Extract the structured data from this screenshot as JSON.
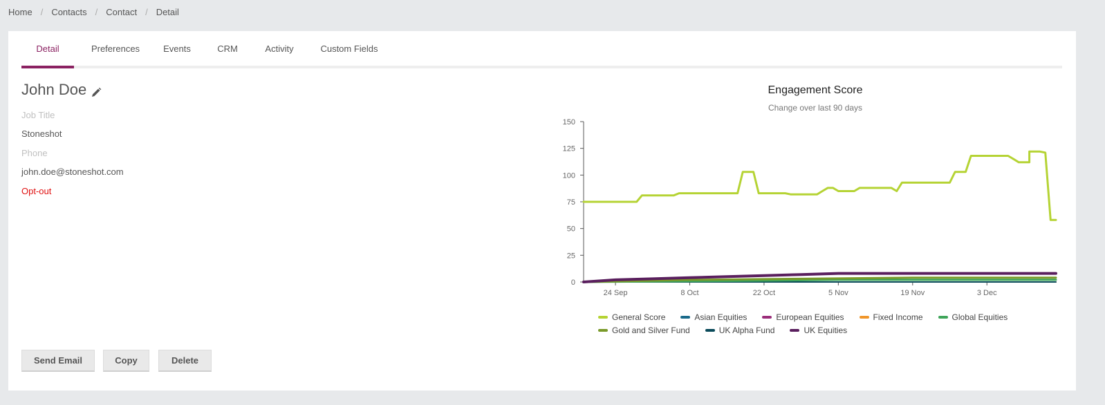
{
  "breadcrumb": [
    "Home",
    "Contacts",
    "Contact",
    "Detail"
  ],
  "breadcrumb_separator": "/",
  "tabs": [
    "Detail",
    "Preferences",
    "Events",
    "CRM",
    "Activity",
    "Custom Fields"
  ],
  "active_tab": "Detail",
  "contact": {
    "name": "John Doe",
    "job_title_placeholder": "Job Title",
    "company": "Stoneshot",
    "phone_placeholder": "Phone",
    "email": "john.doe@stoneshot.com",
    "status": "Opt-out"
  },
  "actions": {
    "send_email": "Send Email",
    "copy": "Copy",
    "delete": "Delete"
  },
  "colors": {
    "accent": "#8b2262",
    "optout": "#e01010"
  },
  "chart_data": {
    "type": "line",
    "title": "Engagement Score",
    "subtitle": "Change over last 90 days",
    "ylim": [
      0,
      150
    ],
    "yticks": [
      0,
      25,
      50,
      75,
      100,
      125,
      150
    ],
    "xlim": [
      "2023-09-18",
      "2023-12-16"
    ],
    "xticks": [
      {
        "x": "2023-09-24",
        "label": "24 Sep"
      },
      {
        "x": "2023-10-08",
        "label": "8 Oct"
      },
      {
        "x": "2023-10-22",
        "label": "22 Oct"
      },
      {
        "x": "2023-11-05",
        "label": "5 Nov"
      },
      {
        "x": "2023-11-19",
        "label": "19 Nov"
      },
      {
        "x": "2023-12-03",
        "label": "3 Dec"
      }
    ],
    "legend_position": "bottom",
    "series": [
      {
        "name": "General Score",
        "color": "#b5d334",
        "width": 3,
        "points": [
          [
            "2023-09-18",
            75
          ],
          [
            "2023-09-28",
            75
          ],
          [
            "2023-09-29",
            81
          ],
          [
            "2023-10-05",
            81
          ],
          [
            "2023-10-06",
            83
          ],
          [
            "2023-10-17",
            83
          ],
          [
            "2023-10-18",
            103
          ],
          [
            "2023-10-20",
            103
          ],
          [
            "2023-10-21",
            83
          ],
          [
            "2023-10-26",
            83
          ],
          [
            "2023-10-27",
            82
          ],
          [
            "2023-11-01",
            82
          ],
          [
            "2023-11-02",
            85
          ],
          [
            "2023-11-03",
            88
          ],
          [
            "2023-11-04",
            88
          ],
          [
            "2023-11-05",
            85
          ],
          [
            "2023-11-08",
            85
          ],
          [
            "2023-11-09",
            88
          ],
          [
            "2023-11-15",
            88
          ],
          [
            "2023-11-16",
            85
          ],
          [
            "2023-11-17",
            93
          ],
          [
            "2023-11-26",
            93
          ],
          [
            "2023-11-27",
            103
          ],
          [
            "2023-11-29",
            103
          ],
          [
            "2023-11-30",
            118
          ],
          [
            "2023-12-07",
            118
          ],
          [
            "2023-12-08",
            115
          ],
          [
            "2023-12-09",
            112
          ],
          [
            "2023-12-11",
            112
          ],
          [
            "2023-12-11",
            122
          ],
          [
            "2023-12-13",
            122
          ],
          [
            "2023-12-14",
            121
          ],
          [
            "2023-12-15",
            58
          ],
          [
            "2023-12-16",
            58
          ]
        ]
      },
      {
        "name": "Asian Equities",
        "color": "#1a6a8a",
        "width": 2,
        "points": [
          [
            "2023-09-18",
            0
          ],
          [
            "2023-12-16",
            0
          ]
        ]
      },
      {
        "name": "European Equities",
        "color": "#9b2d7a",
        "width": 2,
        "points": [
          [
            "2023-09-18",
            0
          ],
          [
            "2023-12-16",
            0
          ]
        ]
      },
      {
        "name": "Fixed Income",
        "color": "#f0962a",
        "width": 2,
        "points": [
          [
            "2023-09-18",
            0
          ],
          [
            "2023-12-16",
            0
          ]
        ]
      },
      {
        "name": "Global Equities",
        "color": "#3fa55a",
        "width": 3,
        "points": [
          [
            "2023-09-18",
            0
          ],
          [
            "2023-10-15",
            1
          ],
          [
            "2023-11-05",
            2
          ],
          [
            "2023-12-16",
            2
          ]
        ]
      },
      {
        "name": "Gold and Silver Fund",
        "color": "#7a9a2a",
        "width": 3,
        "points": [
          [
            "2023-09-18",
            0
          ],
          [
            "2023-10-08",
            2
          ],
          [
            "2023-10-29",
            3
          ],
          [
            "2023-11-19",
            4
          ],
          [
            "2023-12-16",
            4
          ]
        ]
      },
      {
        "name": "UK Alpha Fund",
        "color": "#0a4a5a",
        "width": 2,
        "points": [
          [
            "2023-09-18",
            0
          ],
          [
            "2023-12-16",
            0
          ]
        ]
      },
      {
        "name": "UK Equities",
        "color": "#5a1f5e",
        "width": 4,
        "points": [
          [
            "2023-09-18",
            0
          ],
          [
            "2023-09-24",
            2
          ],
          [
            "2023-10-01",
            3
          ],
          [
            "2023-10-08",
            4
          ],
          [
            "2023-10-15",
            5
          ],
          [
            "2023-10-22",
            6
          ],
          [
            "2023-10-29",
            7
          ],
          [
            "2023-11-05",
            8
          ],
          [
            "2023-11-19",
            8
          ],
          [
            "2023-12-16",
            8
          ]
        ]
      }
    ]
  }
}
